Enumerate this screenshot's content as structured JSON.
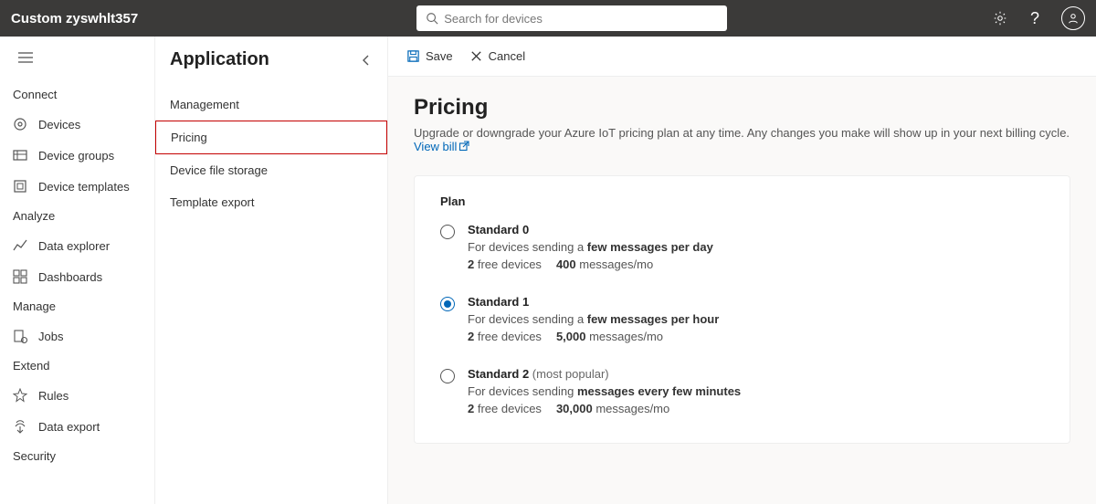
{
  "topbar": {
    "title": "Custom zyswhlt357",
    "search_placeholder": "Search for devices"
  },
  "sidebar1": {
    "sections": [
      {
        "label": "Connect",
        "items": [
          {
            "icon": "devices",
            "label": "Devices"
          },
          {
            "icon": "groups",
            "label": "Device groups"
          },
          {
            "icon": "templates",
            "label": "Device templates"
          }
        ]
      },
      {
        "label": "Analyze",
        "items": [
          {
            "icon": "explorer",
            "label": "Data explorer"
          },
          {
            "icon": "dashboards",
            "label": "Dashboards"
          }
        ]
      },
      {
        "label": "Manage",
        "items": [
          {
            "icon": "jobs",
            "label": "Jobs"
          }
        ]
      },
      {
        "label": "Extend",
        "items": [
          {
            "icon": "rules",
            "label": "Rules"
          },
          {
            "icon": "export",
            "label": "Data export"
          }
        ]
      },
      {
        "label": "Security",
        "items": []
      }
    ]
  },
  "sidebar2": {
    "title": "Application",
    "items": [
      "Management",
      "Pricing",
      "Device file storage",
      "Template export"
    ],
    "active_index": 1
  },
  "toolbar": {
    "save_label": "Save",
    "cancel_label": "Cancel"
  },
  "page": {
    "title": "Pricing",
    "subtitle_prefix": "Upgrade or downgrade your Azure IoT pricing plan at any time. Any changes you make will show up in your next billing cycle. ",
    "view_bill_label": "View bill"
  },
  "plan_card": {
    "header": "Plan",
    "options": [
      {
        "name": "Standard 0",
        "tag": "",
        "desc_prefix": "For devices sending a ",
        "desc_bold": "few messages per day",
        "free_bold": "2",
        "free_text": " free devices",
        "msg_bold": "400",
        "msg_text": " messages/mo",
        "selected": false
      },
      {
        "name": "Standard 1",
        "tag": "",
        "desc_prefix": "For devices sending a ",
        "desc_bold": "few messages per hour",
        "free_bold": "2",
        "free_text": " free devices",
        "msg_bold": "5,000",
        "msg_text": " messages/mo",
        "selected": true
      },
      {
        "name": "Standard 2",
        "tag": " (most popular)",
        "desc_prefix": "For devices sending ",
        "desc_bold": "messages every few minutes",
        "free_bold": "2",
        "free_text": " free devices",
        "msg_bold": "30,000",
        "msg_text": " messages/mo",
        "selected": false
      }
    ]
  }
}
